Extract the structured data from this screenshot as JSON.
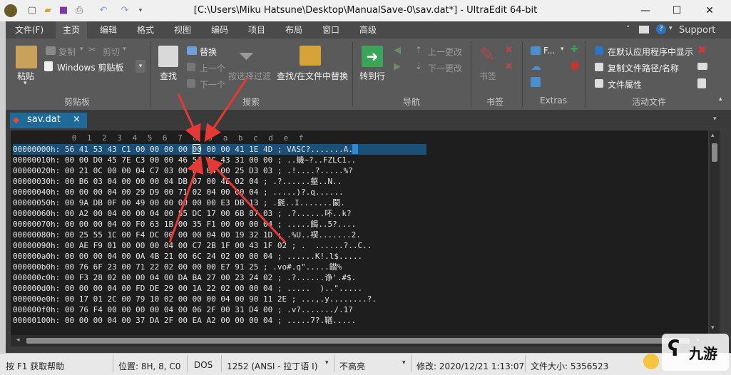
{
  "window": {
    "title": "[C:\\Users\\Miku Hatsune\\Desktop\\ManualSave-0\\sav.dat*] - UltraEdit 64-bit",
    "minimize": "—",
    "maximize": "☐",
    "close": "✕"
  },
  "menu": {
    "items": [
      "文件(F)",
      "主页",
      "编辑",
      "格式",
      "视图",
      "编码",
      "项目",
      "布局",
      "窗口",
      "高级"
    ],
    "active_index": 1,
    "support_label": "Support"
  },
  "ribbon": {
    "clipboard": {
      "paste": "粘贴",
      "copy": "复制",
      "cut": "剪切",
      "clipboard_select": "Windows 剪贴板",
      "group_label": "剪贴板"
    },
    "search": {
      "find": "查找",
      "replace": "替换",
      "prev": "上一个",
      "next": "下一个",
      "filter": "按选择过滤",
      "find_in_files": "查找/在文件中替换",
      "group_label": "搜索"
    },
    "nav": {
      "goto": "转到行",
      "prev_change": "上一更改",
      "next_change": "下一更改",
      "group_label": "导航"
    },
    "bookmarks": {
      "bookmark": "书签",
      "group_label": "书签"
    },
    "extras": {
      "f_label": "F...",
      "group_label": "Extras"
    },
    "active_file": {
      "open_default": "在默认应用程序中显示",
      "copy_path": "复制文件路径/名称",
      "properties": "文件属性",
      "group_label": "活动文件"
    }
  },
  "tab": {
    "name": "sav.dat",
    "close": "×"
  },
  "editor": {
    "columns": [
      "0",
      "1",
      "2",
      "3",
      "4",
      "5",
      "6",
      "7",
      "8",
      "9",
      "a",
      "b",
      "c",
      "d",
      "e",
      "f"
    ],
    "rows": [
      "00000000h: 56 41 53 43 C1 00 00 00 00 00 00 00 41 1E 4D ; VASC?.......A.M",
      "00000010h: 00 00 D0 45 7E C3 00 00 46 5A 4C 43 31 00 00 ; ..蟣~?..FZLC1..",
      "00000020h: 00 21 0C 00 00 04 C7 03 00 00 04 00 25 D3 03 ; .!....?.....%?",
      "00000030h: 00 B6 03 04 00 00 00 04 DB 07 00 4E 02 04 ; .?......壑..N..",
      "00000040h: 00 00 00 04 00 29 D9 00 71 02 04 00 00 04 ; .....)?.q......",
      "00000050h: 00 9A DB 0F 00 49 00 00 00 00 00 E3 DB 13 ; .氀..I.......闞.",
      "00000060h: 00 A2 00 04 00 00 04 00 85 DC 17 00 6B 87 03 ; .?......吥..k?",
      "00000070h: 00 00 00 04 00 F0 63 1B 00 35 F1 00 00 00 04 ; .....餲..5?....",
      "00000080h: 00 25 55 1C 00 F4 DC 00 00 00 04 00 19 32 1D ; .%U..褉.......2.",
      "00000090h: 00 AE F9 01 00 00 00 04 00 C7 2B 1F 00 43 1F 02 ; .  ......?..C..",
      "000000a0h: 00 00 00 04 00 0A 4B 21 00 6C 24 02 00 00 04 ; ......K!.l$.....",
      "000000b0h: 00 76 6F 23 00 71 22 02 00 00 00 E7 91 25 ; .vo#.q\".....鐟%",
      "000000c0h: 00 F3 28 02 00 00 04 00 DA BA 27 00 23 24 02 ; .?......诤'.#$.",
      "000000d0h: 00 00 00 04 00 FD DE 29 00 1A 22 02 00 00 04 ; .....  )..\".....",
      "000000e0h: 00 17 01 2C 00 79 10 02 00 00 00 04 00 90 11 2E ; ...,.y........?.",
      "000000f0h: 00 76 F4 00 00 00 00 04 00 06 2F 00 31 D4 00 ; .v?......./.1?",
      "00000100h: 00 00 00 04 00 37 DA 2F 00 EA A2 00 00 00 04 ; .....7?.鞧....."
    ]
  },
  "status": {
    "help": "按 F1 获取帮助",
    "position": "位置: 8H, 8, C0",
    "line_ending": "DOS",
    "codepage": "1252  (ANSI - 拉丁语 I)",
    "highlight": "不高亮",
    "modified": "修改:   2020/12/21 1:13:07",
    "filesize": "文件大小:   5356523"
  },
  "watermark": "九游"
}
